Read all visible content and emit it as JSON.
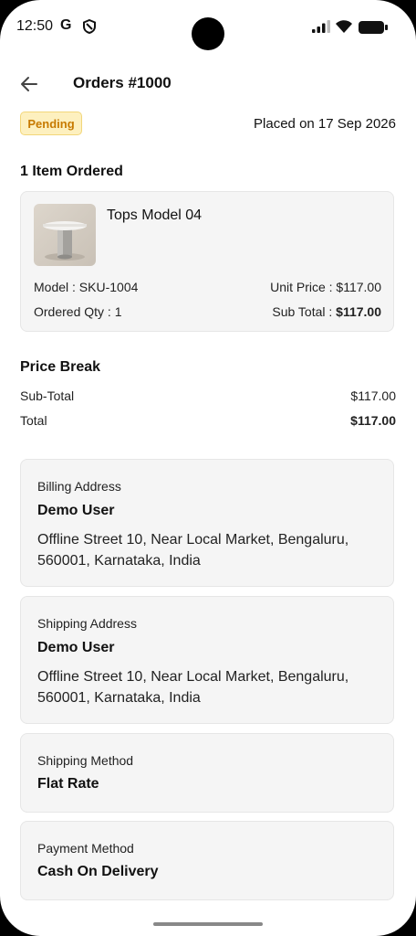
{
  "status_bar": {
    "time": "12:50",
    "google_glyph": "G",
    "icons": [
      "google-icon",
      "shield-icon",
      "signal-icon",
      "wifi-icon",
      "battery-icon"
    ]
  },
  "header": {
    "title": "Orders #1000",
    "back_icon": "arrow-left-icon"
  },
  "order": {
    "status": "Pending",
    "placed_on": "Placed on 17 Sep 2026",
    "items_heading": "1 Item Ordered",
    "item": {
      "name": "Tops Model 04",
      "model": "Model : SKU-1004",
      "unit_price": "Unit Price : $117.00",
      "qty": "Ordered Qty : 1",
      "sub_total_label": "Sub Total : ",
      "sub_total_value": "$117.00"
    }
  },
  "price_break": {
    "heading": "Price Break",
    "subtotal_label": "Sub-Total",
    "subtotal_value": "$117.00",
    "total_label": "Total",
    "total_value": "$117.00"
  },
  "billing": {
    "label": "Billing Address",
    "name": "Demo User",
    "address": "Offline Street 10, Near Local Market, Bengaluru, 560001, Karnataka, India"
  },
  "shipping": {
    "label": "Shipping Address",
    "name": "Demo User",
    "address": "Offline Street 10, Near Local Market, Bengaluru, 560001, Karnataka, India"
  },
  "shipping_method": {
    "label": "Shipping Method",
    "value": "Flat Rate"
  },
  "payment_method": {
    "label": "Payment Method",
    "value": "Cash On Delivery"
  },
  "colors": {
    "pending_bg": "#fdf0bf",
    "pending_text": "#c77a00",
    "card_bg": "#f5f5f5"
  }
}
